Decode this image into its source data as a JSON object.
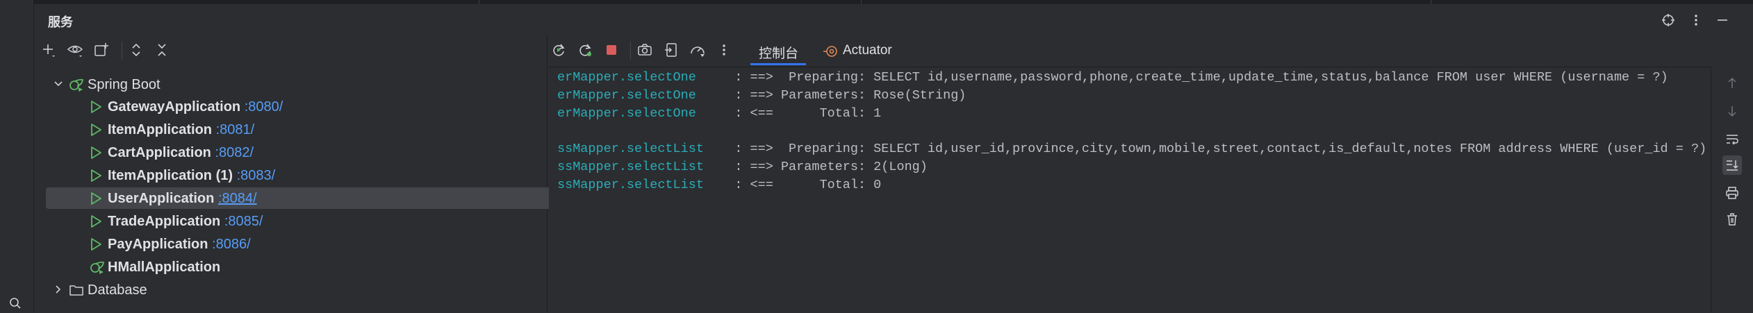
{
  "header": {
    "title": "服务"
  },
  "left_toolbar": {
    "icons": [
      "add-icon",
      "eye-icon",
      "new-group-icon",
      "expand-all-icon",
      "collapse-all-icon"
    ]
  },
  "tree": {
    "spring_boot": {
      "label": "Spring Boot"
    },
    "apps": [
      {
        "name": "GatewayApplication",
        "port": ":8080/"
      },
      {
        "name": "ItemApplication",
        "port": ":8081/"
      },
      {
        "name": "CartApplication",
        "port": ":8082/"
      },
      {
        "name": "ItemApplication (1)",
        "port": ":8083/"
      },
      {
        "name": "UserApplication",
        "port": ":8084/",
        "selected": true
      },
      {
        "name": "TradeApplication",
        "port": ":8085/"
      },
      {
        "name": "PayApplication",
        "port": ":8086/"
      },
      {
        "name": "HMallApplication",
        "port": ""
      }
    ],
    "database": {
      "label": "Database"
    }
  },
  "right_toolbar": {
    "tabs": [
      {
        "label": "控制台",
        "active": true
      },
      {
        "label": "Actuator",
        "active": false
      }
    ]
  },
  "console": {
    "lines": [
      {
        "logger": "erMapper.selectOne",
        "text": "     : ==>  Preparing: SELECT id,username,password,phone,create_time,update_time,status,balance FROM user WHERE (username = ?)"
      },
      {
        "logger": "erMapper.selectOne",
        "text": "     : ==> Parameters: Rose(String)"
      },
      {
        "logger": "erMapper.selectOne",
        "text": "     : <==      Total: 1"
      },
      {
        "logger": "",
        "text": ""
      },
      {
        "logger": "ssMapper.selectList",
        "text": "    : ==>  Preparing: SELECT id,user_id,province,city,town,mobile,street,contact,is_default,notes FROM address WHERE (user_id = ?)"
      },
      {
        "logger": "ssMapper.selectList",
        "text": "    : ==> Parameters: 2(Long)"
      },
      {
        "logger": "ssMapper.selectList",
        "text": "    : <==      Total: 0"
      }
    ]
  },
  "colors": {
    "accent": "#3574f0",
    "port_link": "#589df6",
    "logger": "#2aacb8",
    "run_green": "#5fb865",
    "stop_red": "#db5c5c"
  }
}
